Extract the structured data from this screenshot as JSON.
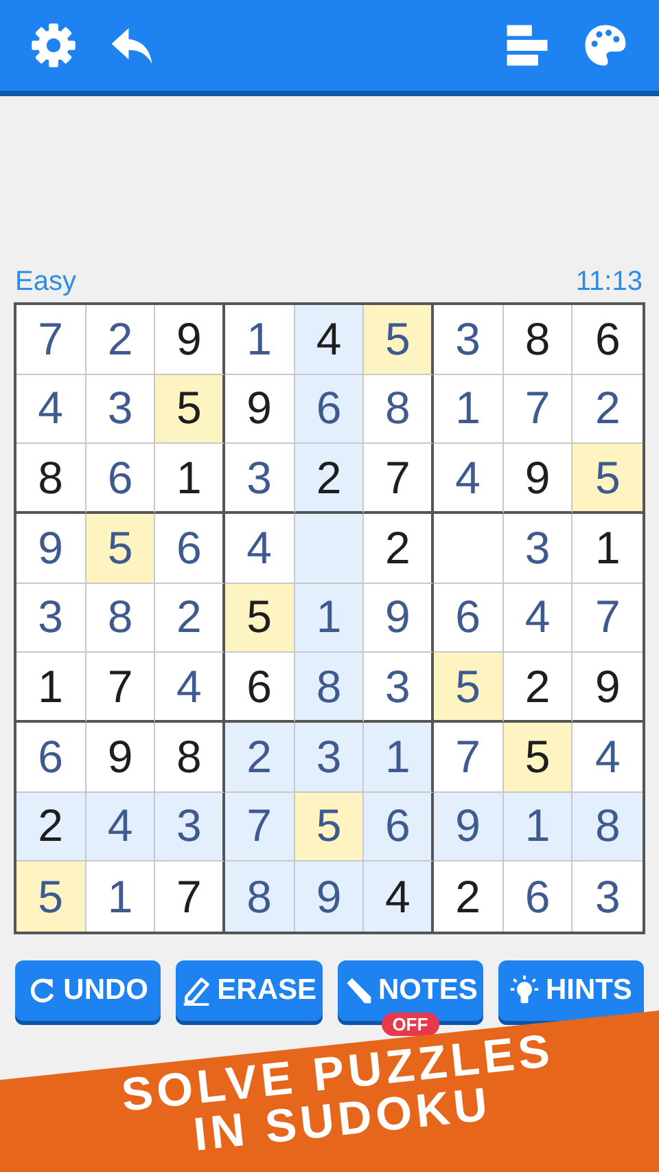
{
  "status": {
    "difficulty": "Easy",
    "time": "11:13"
  },
  "board": {
    "rows": [
      [
        {
          "value": "7",
          "given": false,
          "highlighted": false,
          "same_digit": false
        },
        {
          "value": "2",
          "given": false,
          "highlighted": false,
          "same_digit": false
        },
        {
          "value": "9",
          "given": true,
          "highlighted": false,
          "same_digit": false
        },
        {
          "value": "1",
          "given": false,
          "highlighted": false,
          "same_digit": false
        },
        {
          "value": "4",
          "given": true,
          "highlighted": true,
          "same_digit": false
        },
        {
          "value": "5",
          "given": false,
          "same_digit": true
        },
        {
          "value": "3",
          "given": false,
          "highlighted": false,
          "same_digit": false
        },
        {
          "value": "8",
          "given": true,
          "highlighted": false,
          "same_digit": false
        },
        {
          "value": "6",
          "given": true,
          "highlighted": false,
          "same_digit": false
        }
      ],
      [
        {
          "value": "4",
          "given": false,
          "highlighted": false,
          "same_digit": false
        },
        {
          "value": "3",
          "given": false,
          "highlighted": false,
          "same_digit": false
        },
        {
          "value": "5",
          "given": true,
          "same_digit": true
        },
        {
          "value": "9",
          "given": true,
          "highlighted": false,
          "same_digit": false
        },
        {
          "value": "6",
          "given": false,
          "highlighted": true,
          "same_digit": false
        },
        {
          "value": "8",
          "given": false,
          "highlighted": false,
          "same_digit": false
        },
        {
          "value": "1",
          "given": false,
          "highlighted": false,
          "same_digit": false
        },
        {
          "value": "7",
          "given": false,
          "highlighted": false,
          "same_digit": false
        },
        {
          "value": "2",
          "given": false,
          "highlighted": false,
          "same_digit": false
        }
      ],
      [
        {
          "value": "8",
          "given": true,
          "highlighted": false,
          "same_digit": false
        },
        {
          "value": "6",
          "given": false,
          "highlighted": false,
          "same_digit": false
        },
        {
          "value": "1",
          "given": true,
          "highlighted": false,
          "same_digit": false
        },
        {
          "value": "3",
          "given": false,
          "highlighted": false,
          "same_digit": false
        },
        {
          "value": "2",
          "given": true,
          "highlighted": true,
          "same_digit": false
        },
        {
          "value": "7",
          "given": true,
          "highlighted": false,
          "same_digit": false
        },
        {
          "value": "4",
          "given": false,
          "highlighted": false,
          "same_digit": false
        },
        {
          "value": "9",
          "given": true,
          "highlighted": false,
          "same_digit": false
        },
        {
          "value": "5",
          "given": false,
          "same_digit": true
        }
      ],
      [
        {
          "value": "9",
          "given": false,
          "highlighted": false,
          "same_digit": false
        },
        {
          "value": "5",
          "given": false,
          "same_digit": true
        },
        {
          "value": "6",
          "given": false,
          "highlighted": false,
          "same_digit": false
        },
        {
          "value": "4",
          "given": false,
          "highlighted": false,
          "same_digit": false
        },
        {
          "highlighted": true,
          "same_digit": false
        },
        {
          "value": "2",
          "given": true,
          "highlighted": false,
          "same_digit": false
        },
        {
          "highlighted": false,
          "same_digit": false
        },
        {
          "value": "3",
          "given": false,
          "highlighted": false,
          "same_digit": false
        },
        {
          "value": "1",
          "given": true,
          "highlighted": false,
          "same_digit": false
        }
      ],
      [
        {
          "value": "3",
          "given": false,
          "highlighted": false,
          "same_digit": false
        },
        {
          "value": "8",
          "given": false,
          "highlighted": false,
          "same_digit": false
        },
        {
          "value": "2",
          "given": false,
          "highlighted": false,
          "same_digit": false
        },
        {
          "value": "5",
          "given": true,
          "same_digit": true
        },
        {
          "value": "1",
          "given": false,
          "highlighted": true,
          "same_digit": false
        },
        {
          "value": "9",
          "given": false,
          "highlighted": false,
          "same_digit": false
        },
        {
          "value": "6",
          "given": false,
          "highlighted": false,
          "same_digit": false
        },
        {
          "value": "4",
          "given": false,
          "highlighted": false,
          "same_digit": false
        },
        {
          "value": "7",
          "given": false,
          "highlighted": false,
          "same_digit": false
        }
      ],
      [
        {
          "value": "1",
          "given": true,
          "highlighted": false,
          "same_digit": false
        },
        {
          "value": "7",
          "given": true,
          "highlighted": false,
          "same_digit": false
        },
        {
          "value": "4",
          "given": false,
          "highlighted": false,
          "same_digit": false
        },
        {
          "value": "6",
          "given": true,
          "highlighted": false,
          "same_digit": false
        },
        {
          "value": "8",
          "given": false,
          "highlighted": true,
          "same_digit": false
        },
        {
          "value": "3",
          "given": false,
          "highlighted": false,
          "same_digit": false
        },
        {
          "value": "5",
          "given": false,
          "same_digit": true
        },
        {
          "value": "2",
          "given": true,
          "highlighted": false,
          "same_digit": false
        },
        {
          "value": "9",
          "given": true,
          "highlighted": false,
          "same_digit": false
        }
      ],
      [
        {
          "value": "6",
          "given": false,
          "highlighted": false,
          "same_digit": false
        },
        {
          "value": "9",
          "given": true,
          "highlighted": false,
          "same_digit": false
        },
        {
          "value": "8",
          "given": true,
          "highlighted": false,
          "same_digit": false
        },
        {
          "value": "2",
          "given": false,
          "highlighted": true,
          "same_digit": false
        },
        {
          "value": "3",
          "given": false,
          "highlighted": true,
          "same_digit": false
        },
        {
          "value": "1",
          "given": false,
          "highlighted": true,
          "same_digit": false
        },
        {
          "value": "7",
          "given": false,
          "highlighted": false,
          "same_digit": false
        },
        {
          "value": "5",
          "given": true,
          "same_digit": true
        },
        {
          "value": "4",
          "given": false,
          "highlighted": false,
          "same_digit": false
        }
      ],
      [
        {
          "value": "2",
          "given": true,
          "highlighted": true,
          "same_digit": false
        },
        {
          "value": "4",
          "given": false,
          "highlighted": true,
          "same_digit": false
        },
        {
          "value": "3",
          "given": false,
          "highlighted": true,
          "same_digit": false
        },
        {
          "value": "7",
          "given": false,
          "highlighted": true,
          "same_digit": false
        },
        {
          "value": "5",
          "given": false,
          "same_digit": true
        },
        {
          "value": "6",
          "given": false,
          "highlighted": true,
          "same_digit": false
        },
        {
          "value": "9",
          "given": false,
          "highlighted": true,
          "same_digit": false
        },
        {
          "value": "1",
          "given": false,
          "highlighted": true,
          "same_digit": false
        },
        {
          "value": "8",
          "given": false,
          "highlighted": true,
          "same_digit": false
        }
      ],
      [
        {
          "value": "5",
          "given": false,
          "same_digit": true
        },
        {
          "value": "1",
          "given": false,
          "highlighted": false,
          "same_digit": false
        },
        {
          "value": "7",
          "given": true,
          "highlighted": false,
          "same_digit": false
        },
        {
          "value": "8",
          "given": false,
          "highlighted": true,
          "same_digit": false
        },
        {
          "value": "9",
          "given": false,
          "highlighted": true,
          "same_digit": false
        },
        {
          "value": "4",
          "given": true,
          "highlighted": true,
          "same_digit": false
        },
        {
          "value": "2",
          "given": true,
          "highlighted": false,
          "same_digit": false
        },
        {
          "value": "6",
          "given": false,
          "highlighted": false,
          "same_digit": false
        },
        {
          "value": "3",
          "given": false,
          "highlighted": false,
          "same_digit": false
        }
      ]
    ]
  },
  "actions": [
    {
      "kind": "undo",
      "label": "UNDO"
    },
    {
      "kind": "erase",
      "label": "ERASE"
    },
    {
      "kind": "notes",
      "label": "NOTES",
      "badge": "OFF"
    },
    {
      "kind": "hints",
      "label": "HINTS"
    }
  ],
  "banner": {
    "lines": [
      "SOLVE PUZZLES",
      "IN SUDOKU"
    ]
  }
}
